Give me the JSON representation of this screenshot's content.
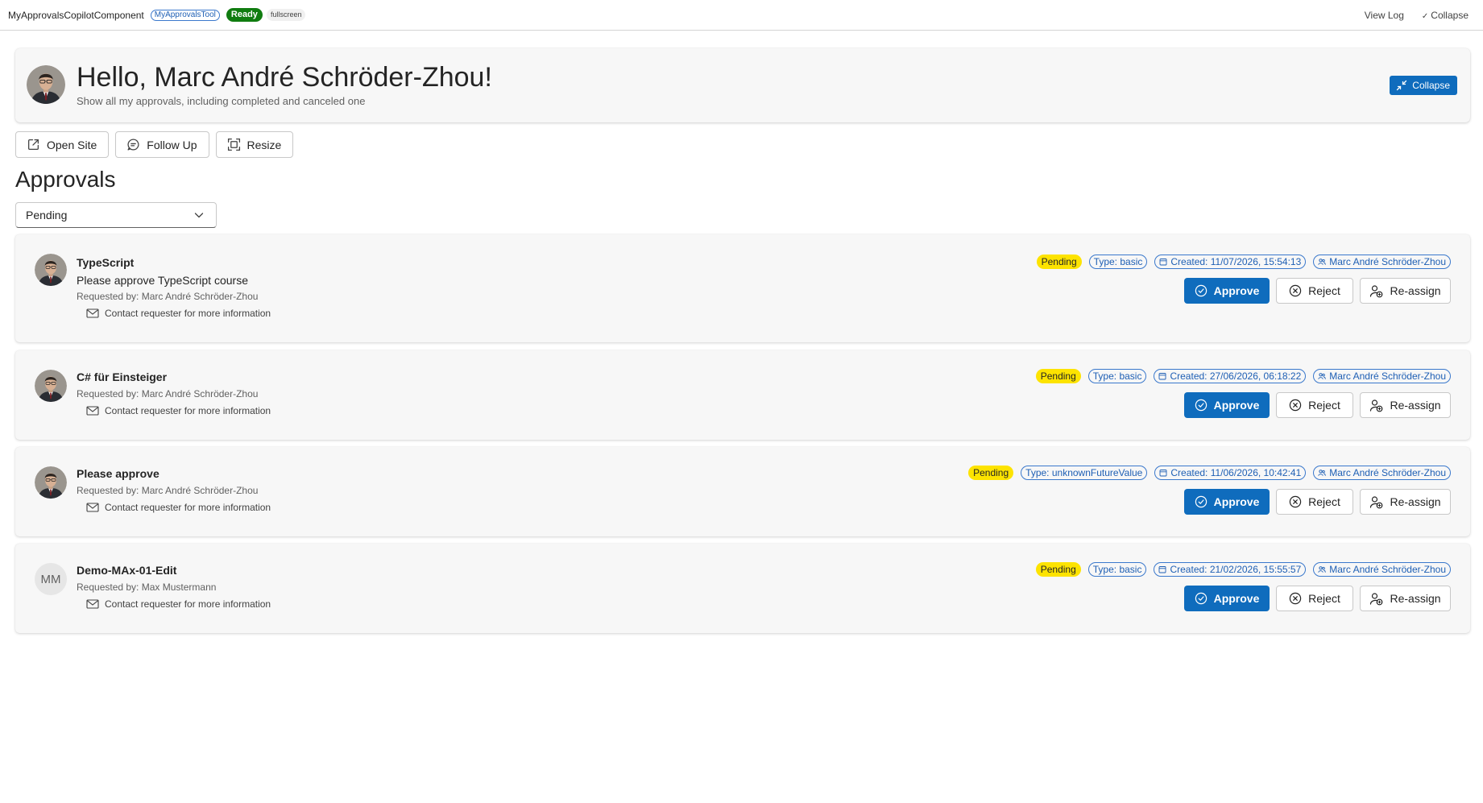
{
  "topbar": {
    "app_title": "MyApprovalsCopilotComponent",
    "tool_badge": "MyApprovalsTool",
    "status_badge": "Ready",
    "mode_badge": "fullscreen",
    "view_log": "View Log",
    "collapse": "Collapse"
  },
  "hero": {
    "title": "Hello, Marc André Schröder-Zhou!",
    "subtitle": "Show all my approvals, including completed and canceled one",
    "collapse_label": "Collapse"
  },
  "actions": {
    "open_site": "Open Site",
    "follow_up": "Follow Up",
    "resize": "Resize"
  },
  "section_title": "Approvals",
  "filter": {
    "selected": "Pending"
  },
  "labels": {
    "approve": "Approve",
    "reject": "Reject",
    "reassign": "Re-assign",
    "contact": "Contact requester for more information"
  },
  "colors": {
    "accent": "#0f6cbd",
    "ready": "#107c10",
    "pending": "#fde300",
    "tag_border": "#3a78cc"
  },
  "approvals": [
    {
      "title": "TypeScript",
      "description": "Please approve TypeScript course",
      "requested_by": "Requested by: Marc André Schröder-Zhou",
      "status": "Pending",
      "type": "Type: basic",
      "created": "Created: 11/07/2026, 15:54:13",
      "assignee": "Marc André Schröder-Zhou"
    },
    {
      "title": "C# für Einsteiger",
      "requested_by": "Requested by: Marc André Schröder-Zhou",
      "status": "Pending",
      "type": "Type: basic",
      "created": "Created: 27/06/2026, 06:18:22",
      "assignee": "Marc André Schröder-Zhou"
    },
    {
      "title": "Please approve",
      "requested_by": "Requested by: Marc André Schröder-Zhou",
      "status": "Pending",
      "type": "Type: unknownFutureValue",
      "created": "Created: 11/06/2026, 10:42:41",
      "assignee": "Marc André Schröder-Zhou"
    },
    {
      "title": "Demo-MAx-01-Edit",
      "requested_by": "Requested by: Max Mustermann",
      "avatar_initials": "MM",
      "status": "Pending",
      "type": "Type: basic",
      "created": "Created: 21/02/2026, 15:55:57",
      "assignee": "Marc André Schröder-Zhou"
    }
  ]
}
